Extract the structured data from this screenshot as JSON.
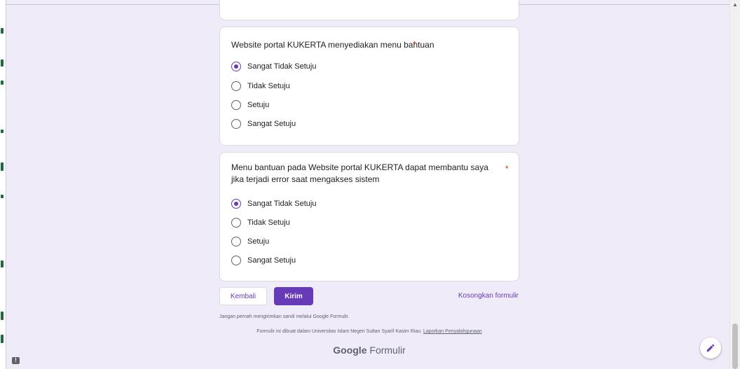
{
  "questions": [
    {
      "title": "Website portal KUKERTA menyediakan menu bantuan",
      "required_mark": "*",
      "options": [
        "Sangat Tidak Setuju",
        "Tidak Setuju",
        "Setuju",
        "Sangat Setuju"
      ],
      "selected": "Sangat Tidak Setuju"
    },
    {
      "title": "Menu bantuan pada Website portal KUKERTA dapat membantu saya jika terjadi error saat mengakses sistem",
      "required_mark": "*",
      "options": [
        "Sangat Tidak Setuju",
        "Tidak Setuju",
        "Setuju",
        "Sangat Setuju"
      ],
      "selected": "Sangat Tidak Setuju"
    }
  ],
  "actions": {
    "back_label": "Kembali",
    "submit_label": "Kirim",
    "clear_label": "Kosongkan formulir"
  },
  "footer": {
    "password_note": "Jangan pernah mengirimkan sandi melalui Google Formulir.",
    "created_in": "Formulir ini dibuat dalam Universitas Islam Negeri Sultan Syarif Kasim Riau.",
    "report_link": "Laporkan Penyalahgunaan",
    "brand_google": "Google",
    "brand_product": "Formulir"
  },
  "icons": {
    "edit": "pencil-icon",
    "report": "report-icon"
  },
  "colors": {
    "accent": "#673ab7",
    "background": "#f0ebf8",
    "required": "#d93025"
  }
}
